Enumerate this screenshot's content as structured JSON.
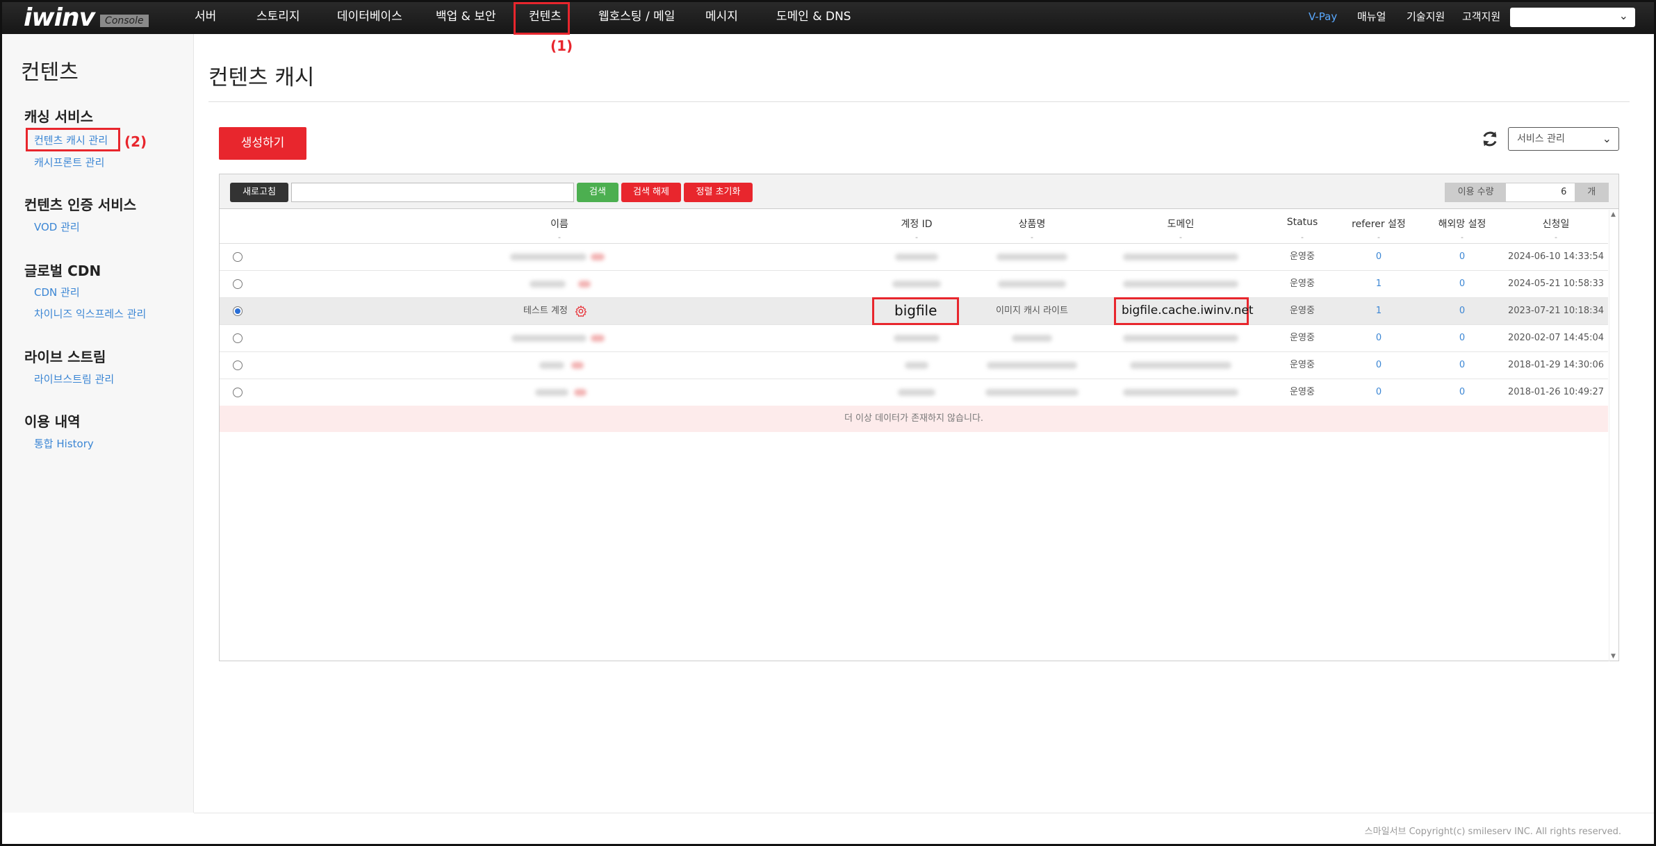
{
  "topnav": {
    "logo": "iwinv",
    "console_badge": "Console",
    "items": [
      "서버",
      "스토리지",
      "데이터베이스",
      "백업 & 보안",
      "컨텐츠",
      "웹호스팅 / 메일",
      "메시지",
      "도메인 & DNS"
    ],
    "right_items": [
      "V-Pay",
      "매뉴얼",
      "기술지원",
      "고객지원"
    ],
    "select_value": ""
  },
  "annotations": {
    "label1": "(1)",
    "label2": "(2)"
  },
  "sidebar": {
    "title": "컨텐츠",
    "groups": [
      {
        "label": "캐싱 서비스",
        "links": [
          "컨텐츠 캐시 관리",
          "캐시프론트 관리"
        ]
      },
      {
        "label": "컨텐츠 인증 서비스",
        "links": [
          "VOD 관리"
        ]
      },
      {
        "label": "글로벌 CDN",
        "links": [
          "CDN 관리",
          "차이니즈 익스프레스 관리"
        ]
      },
      {
        "label": "라이브 스트림",
        "links": [
          "라이브스트림 관리"
        ]
      },
      {
        "label": "이용 내역",
        "links": [
          "통합 History"
        ]
      }
    ]
  },
  "main": {
    "title": "컨텐츠 캐시",
    "create_label": "생성하기",
    "service_select": "서비스 관리",
    "toolbar": {
      "refresh_label": "새로고침",
      "search_label": "검색",
      "clear_label": "검색 해제",
      "reset_sort_label": "정렬 초기화",
      "usage_label": "이용 수량",
      "usage_value": "6",
      "usage_unit": "개"
    },
    "table": {
      "headers": [
        "이름",
        "계정 ID",
        "상품명",
        "도메인",
        "Status",
        "referer 설정",
        "해외망 설정",
        "신청일"
      ],
      "filter_dot": "-",
      "rows": [
        {
          "status": "운영중",
          "referer": "0",
          "overseas": "0",
          "date": "2024-06-10 14:33:54"
        },
        {
          "status": "운영중",
          "referer": "1",
          "overseas": "0",
          "date": "2024-05-21 10:58:33"
        },
        {
          "name": "테스트 계정",
          "account": "bigfile",
          "product": "이미지 캐시 라이트",
          "domain": "bigfile.cache.iwinv.net",
          "status": "운영중",
          "referer": "1",
          "overseas": "0",
          "date": "2023-07-21 10:18:34"
        },
        {
          "status": "운영중",
          "referer": "0",
          "overseas": "0",
          "date": "2020-02-07 14:45:04"
        },
        {
          "status": "운영중",
          "referer": "0",
          "overseas": "0",
          "date": "2018-01-29 14:30:06"
        },
        {
          "status": "운영중",
          "referer": "0",
          "overseas": "0",
          "date": "2018-01-26 10:49:27"
        }
      ],
      "no_more": "더 이상 데이터가 존재하지 않습니다."
    }
  },
  "footer": "스마일서브 Copyright(c) smileserv INC. All rights reserved.",
  "colors": {
    "accent_red": "#e8262d",
    "link_blue": "#3b86d4",
    "search_green": "#4caf50"
  }
}
